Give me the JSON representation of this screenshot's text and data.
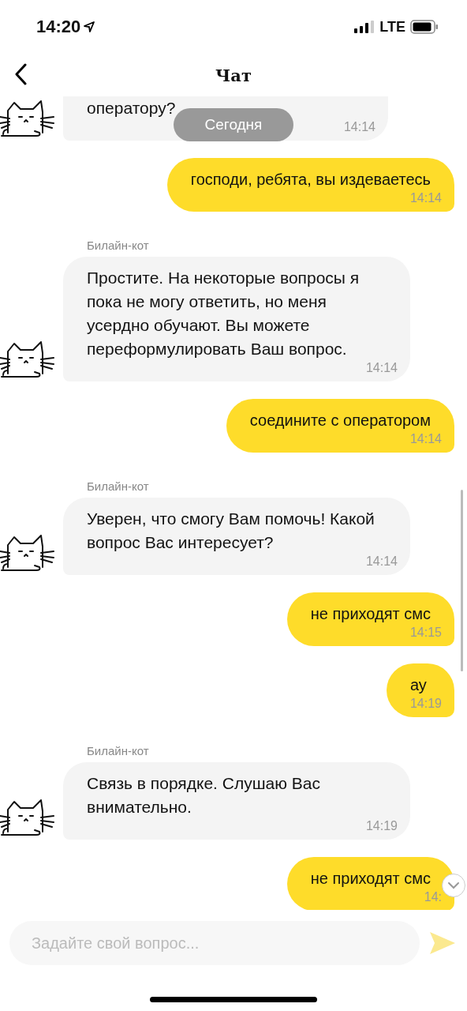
{
  "status_bar": {
    "time": "14:20",
    "network": "LTE"
  },
  "header": {
    "title": "Чат"
  },
  "date_pill": "Сегодня",
  "messages": [
    {
      "kind": "bot",
      "cut": true,
      "text": "оператору?",
      "time": "14:14"
    },
    {
      "kind": "user",
      "text": "господи, ребята, вы издеваетесь",
      "time": "14:14"
    },
    {
      "kind": "bot",
      "sender": "Билайн-кот",
      "text": "Простите. На некоторые вопросы я пока не могу ответить, но меня усердно обучают.  Вы можете переформулировать Ваш вопрос.",
      "time": "14:14"
    },
    {
      "kind": "user",
      "text": "соедините с оператором",
      "time": "14:14"
    },
    {
      "kind": "bot",
      "sender": "Билайн-кот",
      "text": "Уверен, что смогу Вам помочь! Какой вопрос Вас интересует?",
      "time": "14:14"
    },
    {
      "kind": "user",
      "text": "не приходят смс",
      "time": "14:15"
    },
    {
      "kind": "user",
      "text": "ау",
      "time": "14:19"
    },
    {
      "kind": "bot",
      "sender": "Билайн-кот",
      "text": "Связь в порядке. Слушаю Вас внимательно.",
      "time": "14:19"
    },
    {
      "kind": "user",
      "text": "не приходят смс",
      "time": "14:"
    }
  ],
  "composer": {
    "placeholder": "Задайте свой вопрос..."
  }
}
